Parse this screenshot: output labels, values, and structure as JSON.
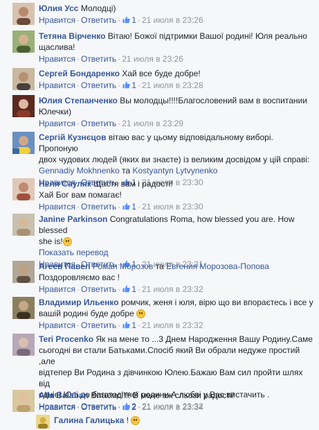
{
  "ui": {
    "like": "Нравится",
    "reply": "Ответить",
    "sep": "·",
    "see_translation": "Показать перевод"
  },
  "comments": [
    {
      "author": "Юлия Усс",
      "text": "Молодці)",
      "likes": "1",
      "time": "21 июля в 23:26",
      "avatar_color": "#b98a6a"
    },
    {
      "author": "Тетяна Вірченко",
      "text": "Вітаю! Божої підтримки Вашої родині! Юля реально",
      "text2": "щаслива!",
      "likes": "",
      "time": "21 июля в 23:26",
      "avatar_color": "#6d8a4a"
    },
    {
      "author": "Сергей Бондаренко",
      "text": "Хай все буде добре!",
      "likes": "1",
      "time": "21 июля в 23:28",
      "avatar_color": "#7a6a58"
    },
    {
      "author": "Юлия Степанченко",
      "text": "Вы молодцы!!!!Благословений вам в воспитании",
      "text2": "Юлечки)",
      "likes": "",
      "time": "21 июля в 23:29",
      "avatar_color": "#8a3a2a"
    },
    {
      "author": "Сергій Кузнєцов",
      "text": "вітаю вас у цьому відповідальному виборі. Пропоную",
      "text2": "двох чудових людей (яких ви знаєте) із великим досвідом у цій справі:",
      "mention1": "Gennadiy Mokhnenko",
      "and": "та",
      "mention2": "Kostyantyn Lytvynenko",
      "likes": "1",
      "time": "21 июля в 23:30",
      "avatar_color": "#3a6aa0"
    },
    {
      "author": "Неля Сауляк",
      "text": "Щастя вам і радості!",
      "text2": "Хай Бог вам помагає!",
      "likes": "1",
      "time": "21 июля в 23:30",
      "avatar_color": "#c08a70"
    },
    {
      "author": "Janine Parkinson",
      "text": "Congratulations Roma, how blessed you are. How blessed",
      "text2": "she is!",
      "likes": "1",
      "time": "21 июля в 23:31",
      "avatar_color": "#a89070"
    },
    {
      "author": "Агеев Павел",
      "mention1": "Роман Морозов",
      "and": "та",
      "mention2": "Евгения Морозова-Попова",
      "text2": "Поздоровляємо вас !",
      "likes": "1",
      "time": "21 июля в 23:32",
      "avatar_color": "#8a7560"
    },
    {
      "author": "Владимир Ильенко",
      "text": "ромчик, женя і юля, вірю що ви впораєтесь і все у",
      "text2": "вашій родині буде добре",
      "likes": "1",
      "time": "21 июля в 23:32",
      "avatar_color": "#5a5040"
    },
    {
      "author": "Teri Procenko",
      "text": "Як на мене то ...3 Днем Народження Вашу Родину.Саме",
      "text2": "сьогодні ви стали Батьками.Спосіб який Ви обрали недуже простий ,але",
      "text3": "відтепер Ви Родина з дівчинкою Юлею.Бажаю Вам сил пройти шлях від",
      "text4": "однієї Юлі до багатодітної родини.А любві у Вас вистачить .",
      "likes": "2",
      "time": "21 июля в 23:32",
      "avatar_color": "#9a8a9a"
    },
    {
      "author": "Alla Balaban",
      "text": "Вітаємо!!!! В мене аж сльози радості!",
      "likes": "2",
      "time": "21 июля в 23:34",
      "avatar_color": "#c0a070"
    },
    {
      "author": "Галина Галицька",
      "text": "!",
      "avatar_color": "#d8b040"
    }
  ],
  "colors": {
    "link": "#365899",
    "meta": "#90949c",
    "text": "#1d2129",
    "bg": "#f6f7f9"
  }
}
